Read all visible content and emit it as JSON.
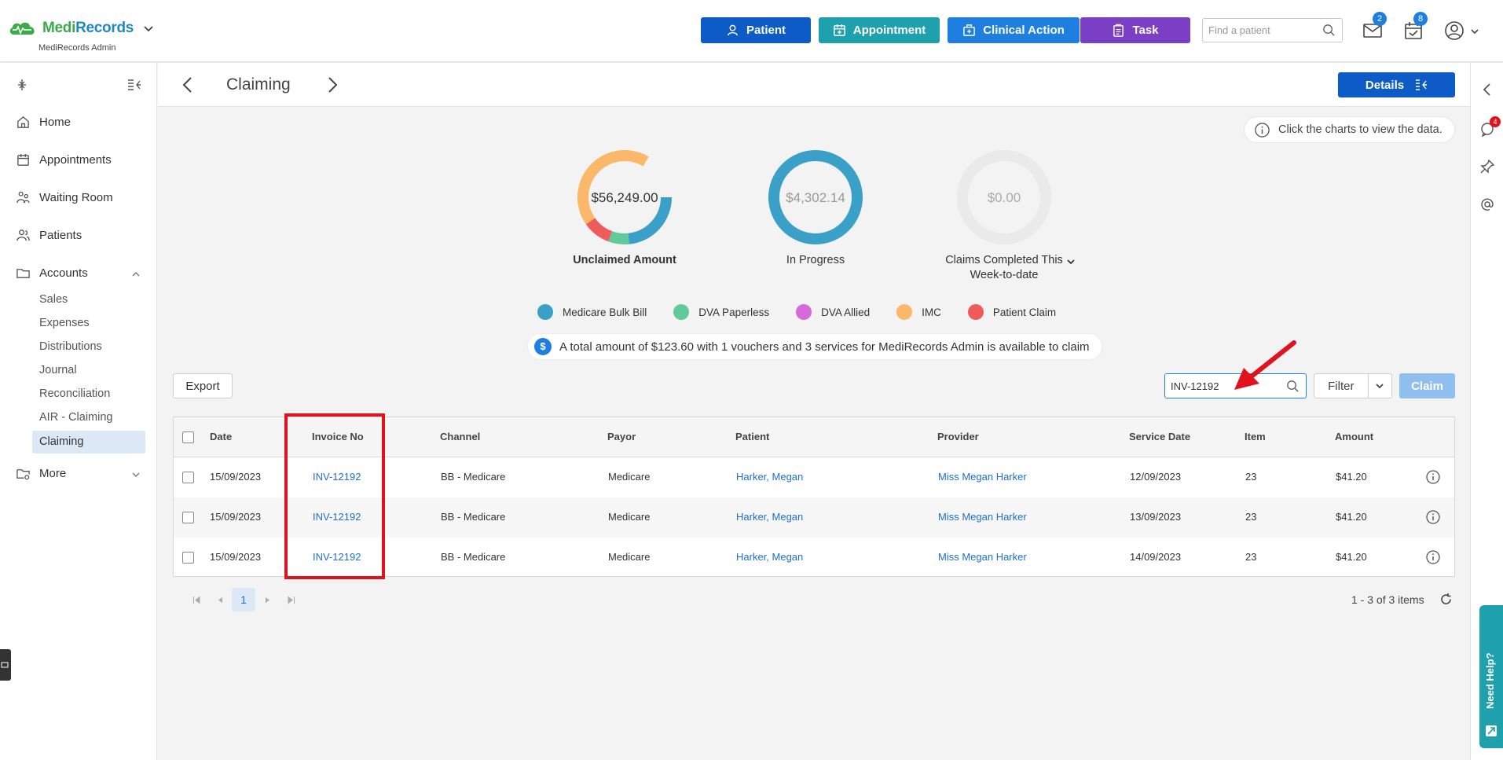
{
  "brand": {
    "name_part1": "Medi",
    "name_part2": "Records",
    "subtitle": "MediRecords Admin"
  },
  "topbar": {
    "buttons": {
      "patient": "Patient",
      "appointment": "Appointment",
      "clinical_action": "Clinical Action",
      "task": "Task"
    },
    "find_patient_placeholder": "Find a patient",
    "mail_badge": "2",
    "calendar_badge": "8"
  },
  "sidebar": {
    "items": {
      "home": "Home",
      "appointments": "Appointments",
      "waiting_room": "Waiting Room",
      "patients": "Patients",
      "accounts": "Accounts",
      "more": "More"
    },
    "accounts_sub": [
      "Sales",
      "Expenses",
      "Distributions",
      "Journal",
      "Reconciliation",
      "AIR - Claiming",
      "Claiming"
    ]
  },
  "page": {
    "title": "Claiming",
    "details_label": "Details",
    "hint": "Click the charts to view the data."
  },
  "charts": {
    "unclaimed": {
      "value": "$56,249.00",
      "label": "Unclaimed Amount"
    },
    "in_progress": {
      "value": "$4,302.14",
      "label": "In Progress"
    },
    "completed": {
      "value": "$0.00",
      "label": "Claims Completed This Week-to-date"
    }
  },
  "legend": [
    {
      "label": "Medicare Bulk Bill",
      "color": "#3aa0c8"
    },
    {
      "label": "DVA Paperless",
      "color": "#62c99a"
    },
    {
      "label": "DVA Allied",
      "color": "#d66ad8"
    },
    {
      "label": "IMC",
      "color": "#fbb76a"
    },
    {
      "label": "Patient Claim",
      "color": "#ef5b5b"
    }
  ],
  "notice": {
    "icon": "$",
    "text": "A total amount of $123.60 with 1 vouchers and 3 services for MediRecords Admin is available to claim"
  },
  "toolbar": {
    "export_label": "Export",
    "search_value": "INV-12192",
    "filter_label": "Filter",
    "claim_label": "Claim"
  },
  "table": {
    "headers": {
      "date": "Date",
      "invoice_no": "Invoice No",
      "channel": "Channel",
      "payor": "Payor",
      "patient": "Patient",
      "provider": "Provider",
      "service_date": "Service Date",
      "item": "Item",
      "amount": "Amount"
    },
    "rows": [
      {
        "date": "15/09/2023",
        "invoice_no": "INV-12192",
        "channel": "BB - Medicare",
        "payor": "Medicare",
        "patient": "Harker, Megan",
        "provider": "Miss Megan Harker",
        "service_date": "12/09/2023",
        "item": "23",
        "amount": "$41.20"
      },
      {
        "date": "15/09/2023",
        "invoice_no": "INV-12192",
        "channel": "BB - Medicare",
        "payor": "Medicare",
        "patient": "Harker, Megan",
        "provider": "Miss Megan Harker",
        "service_date": "13/09/2023",
        "item": "23",
        "amount": "$41.20"
      },
      {
        "date": "15/09/2023",
        "invoice_no": "INV-12192",
        "channel": "BB - Medicare",
        "payor": "Medicare",
        "patient": "Harker, Megan",
        "provider": "Miss Megan Harker",
        "service_date": "14/09/2023",
        "item": "23",
        "amount": "$41.20"
      }
    ]
  },
  "pager": {
    "current_page": "1",
    "items_text": "1 - 3 of 3 items"
  },
  "rail": {
    "notification_badge": "4",
    "need_help_label": "Need Help?"
  }
}
